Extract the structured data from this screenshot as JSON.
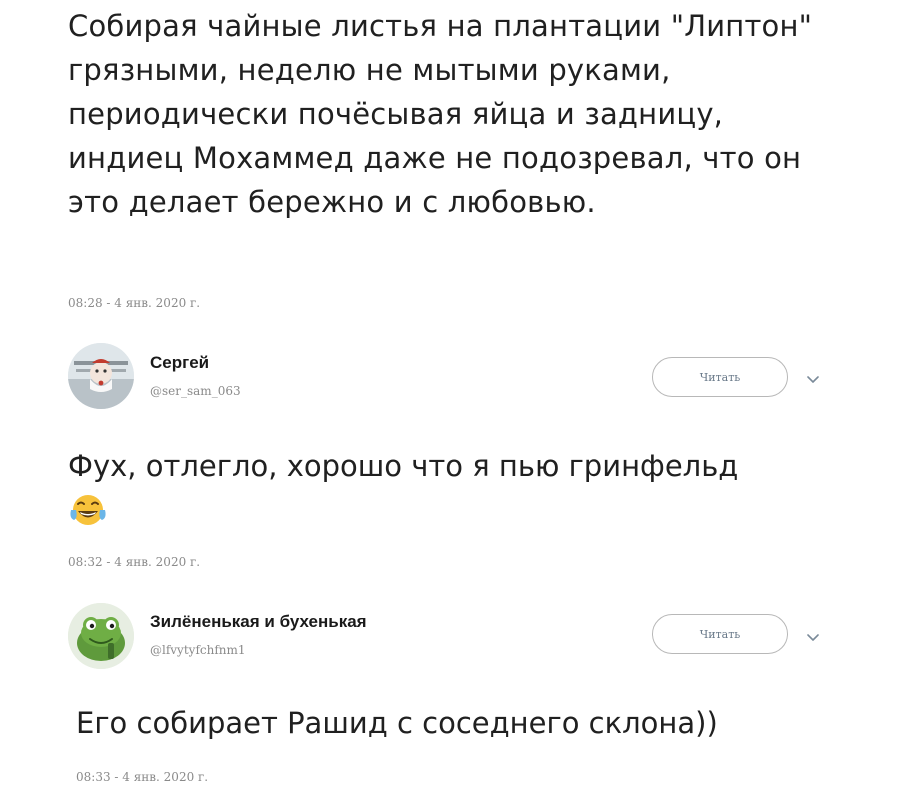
{
  "original_tweet": {
    "text": "Собирая чайные листья на плантации \"Липтон\" грязными, неделю не мытыми руками, периодически почёсывая яйца и задницу, индиец Мохаммед даже не подозревал, что он это делает бережно и с любовью.",
    "timestamp": "08:28 - 4 янв. 2020 г."
  },
  "reply_1": {
    "name": "Сергей",
    "handle": "@ser_sam_063",
    "follow_label": "Читать",
    "text": "Фух, отлегло, хорошо что я пью гринфельд",
    "emoji_icon": "tears-of-joy-emoji-icon",
    "timestamp": "08:32 - 4 янв. 2020 г."
  },
  "reply_2": {
    "name": "Зилёненькая и бухенькая",
    "handle": "@lfvytyfchfnm1",
    "follow_label": "Читать",
    "text": "Его собирает Рашид с соседнего склона))",
    "timestamp": "08:33 - 4 янв. 2020 г."
  },
  "colors": {
    "text": "#202020",
    "muted": "#8a8a8a",
    "button_border": "#b8b8b8",
    "emoji_yellow": "#f7c23b",
    "avatar_green": "#5f9a3c"
  }
}
